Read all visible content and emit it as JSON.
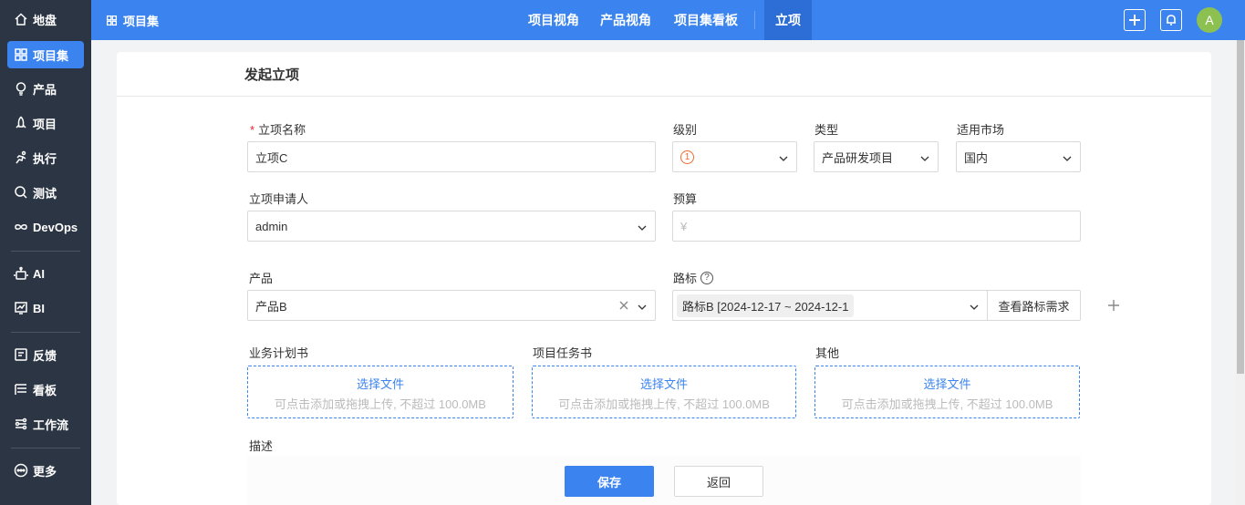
{
  "sidebar": {
    "items": [
      {
        "label": "地盘",
        "icon": "home-icon"
      },
      {
        "label": "项目集",
        "icon": "grid-icon",
        "active": true
      },
      {
        "label": "产品",
        "icon": "bulb-icon"
      },
      {
        "label": "项目",
        "icon": "rocket-icon"
      },
      {
        "label": "执行",
        "icon": "run-icon"
      },
      {
        "label": "测试",
        "icon": "magnifier-icon"
      },
      {
        "label": "DevOps",
        "icon": "infinity-icon"
      },
      {
        "label": "AI",
        "icon": "robot-icon"
      },
      {
        "label": "BI",
        "icon": "chart-icon"
      },
      {
        "label": "反馈",
        "icon": "feedback-icon"
      },
      {
        "label": "看板",
        "icon": "kanban-icon"
      },
      {
        "label": "工作流",
        "icon": "workflow-icon"
      },
      {
        "label": "更多",
        "icon": "more-icon"
      }
    ]
  },
  "topbar": {
    "crumb": "项目集",
    "nav": [
      "项目视角",
      "产品视角",
      "项目集看板",
      "立项"
    ],
    "active_nav": "立项",
    "avatar": "A"
  },
  "form": {
    "title": "发起立项",
    "name_label": "立项名称",
    "name_value": "立项C",
    "level_label": "级别",
    "level_value": "1",
    "type_label": "类型",
    "type_value": "产品研发项目",
    "market_label": "适用市场",
    "market_value": "国内",
    "applicant_label": "立项申请人",
    "applicant_value": "admin",
    "budget_label": "预算",
    "budget_placeholder": "¥",
    "product_label": "产品",
    "product_value": "产品B",
    "roadmap_label": "路标",
    "roadmap_value": "路标B [2024-12-17 ~ 2024-12-1",
    "roadmap_button": "查看路标需求",
    "uploads": [
      {
        "label": "业务计划书",
        "action": "选择文件",
        "hint": "可点击添加或拖拽上传, 不超过 100.0MB"
      },
      {
        "label": "项目任务书",
        "action": "选择文件",
        "hint": "可点击添加或拖拽上传, 不超过 100.0MB"
      },
      {
        "label": "其他",
        "action": "选择文件",
        "hint": "可点击添加或拖拽上传, 不超过 100.0MB"
      }
    ],
    "desc_label": "描述",
    "save_label": "保存",
    "back_label": "返回"
  },
  "colors": {
    "primary": "#3b84f0",
    "sidebar_bg": "#2b3543",
    "level_badge": "#f06a2a",
    "required": "#f5222d"
  }
}
